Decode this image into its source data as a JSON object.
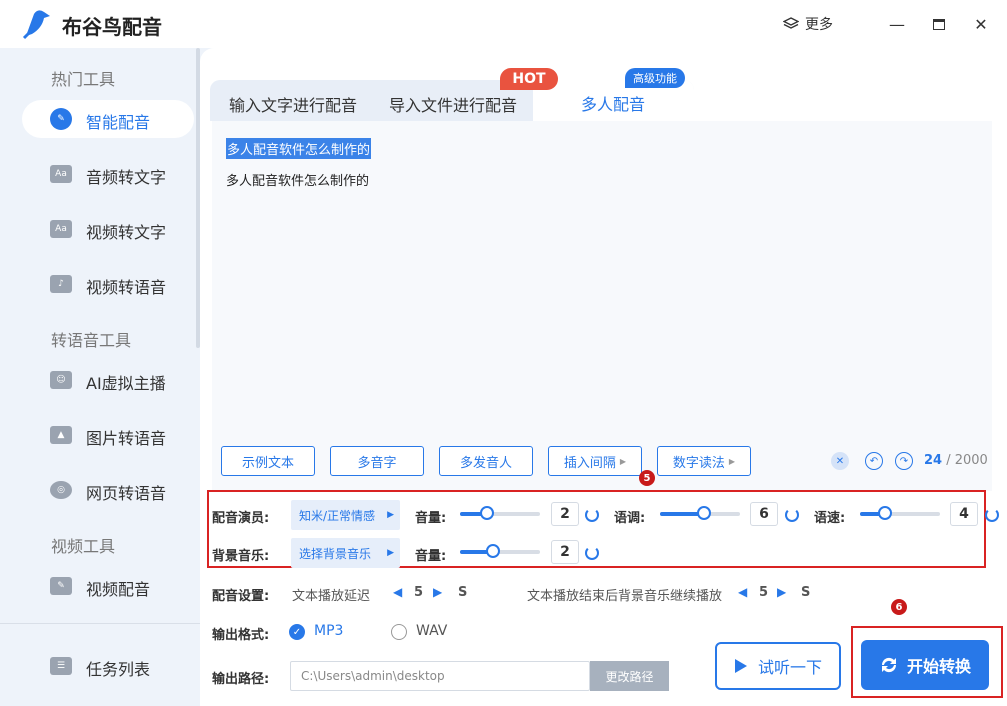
{
  "app": {
    "title": "布谷鸟配音",
    "more_label": "更多"
  },
  "sidebar": {
    "sections": [
      {
        "title": "热门工具"
      },
      {
        "title": "转语音工具"
      },
      {
        "title": "视频工具"
      }
    ],
    "items": [
      {
        "label": "智能配音",
        "icon": "smart-dub-icon",
        "active": true
      },
      {
        "label": "音频转文字",
        "icon": "audio-text-icon",
        "icon_text": "Aa"
      },
      {
        "label": "视频转文字",
        "icon": "video-text-icon",
        "icon_text": "Aa"
      },
      {
        "label": "视频转语音",
        "icon": "video-voice-icon"
      },
      {
        "label": "AI虚拟主播",
        "icon": "virtual-host-icon"
      },
      {
        "label": "图片转语音",
        "icon": "image-voice-icon"
      },
      {
        "label": "网页转语音",
        "icon": "web-voice-icon"
      },
      {
        "label": "视频配音",
        "icon": "video-dub-icon"
      }
    ],
    "task_list": "任务列表"
  },
  "tabs": [
    {
      "label": "输入文字进行配音"
    },
    {
      "label": "导入文件进行配音"
    },
    {
      "label": "多人配音",
      "active": true
    }
  ],
  "badges": {
    "hot": "HOT",
    "advanced": "高级功能"
  },
  "editor": {
    "line1": "多人配音软件怎么制作的",
    "line2": "多人配音软件怎么制作的"
  },
  "toolbar": {
    "buttons": [
      "示例文本",
      "多音字",
      "多发音人",
      "插入间隔",
      "数字读法"
    ],
    "counter_value": "24",
    "counter_max": "/ 2000"
  },
  "markers": {
    "five": "5",
    "six": "6"
  },
  "voice": {
    "actor_label": "配音演员:",
    "actor_value": "知米/正常情感",
    "volume_label": "音量:",
    "volume_value": "2",
    "pitch_label": "语调:",
    "pitch_value": "6",
    "speed_label": "语速:",
    "speed_value": "4",
    "bgm_label": "背景音乐:",
    "bgm_value": "选择背景音乐",
    "bgm_volume_label": "音量:",
    "bgm_volume_value": "2"
  },
  "settings": {
    "label": "配音设置:",
    "delay_label": "文本播放延迟",
    "delay_value": "5",
    "delay_unit": "S",
    "continue_label": "文本播放结束后背景音乐继续播放",
    "continue_value": "5",
    "continue_unit": "S"
  },
  "output": {
    "format_label": "输出格式:",
    "mp3": "MP3",
    "wav": "WAV",
    "selected": "MP3",
    "path_label": "输出路径:",
    "path_value": "C:\\Users\\admin\\desktop",
    "change_path": "更改路径"
  },
  "actions": {
    "listen": "试听一下",
    "start": "开始转换"
  },
  "colors": {
    "accent": "#2878e8",
    "hot": "#e9533f",
    "highlight": "#d92323"
  }
}
